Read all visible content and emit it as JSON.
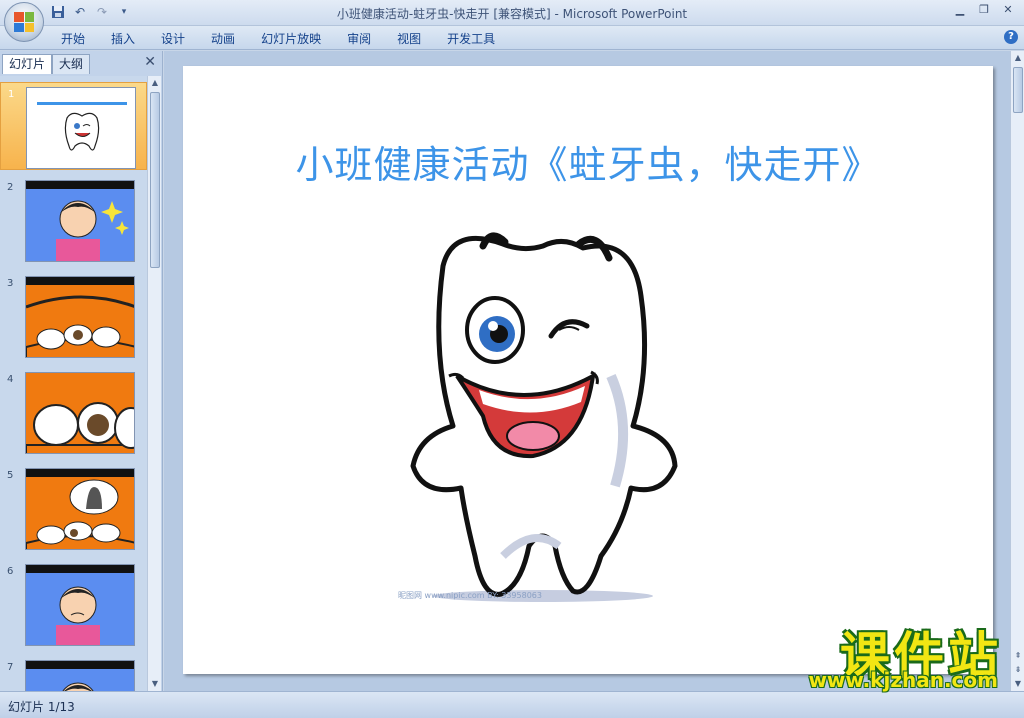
{
  "window": {
    "title": "小班健康活动-蛀牙虫-快走开 [兼容模式] - Microsoft PowerPoint",
    "minimize_icon": "minimize-icon",
    "restore_icon": "restore-icon",
    "close_icon": "close-icon"
  },
  "ribbon": {
    "tabs": [
      {
        "label": "开始"
      },
      {
        "label": "插入"
      },
      {
        "label": "设计"
      },
      {
        "label": "动画"
      },
      {
        "label": "幻灯片放映"
      },
      {
        "label": "审阅"
      },
      {
        "label": "视图"
      },
      {
        "label": "开发工具"
      }
    ],
    "help_icon": "help-icon"
  },
  "quick_access": {
    "icons": [
      "save-icon",
      "undo-icon",
      "redo-icon",
      "customize-icon"
    ]
  },
  "left_panel": {
    "tabs": [
      {
        "label": "幻灯片",
        "active": true
      },
      {
        "label": "大纲",
        "active": false
      }
    ],
    "close_icon": "close-icon",
    "thumbnails": [
      {
        "number": "1",
        "selected": true
      },
      {
        "number": "2",
        "selected": false
      },
      {
        "number": "3",
        "selected": false
      },
      {
        "number": "4",
        "selected": false
      },
      {
        "number": "5",
        "selected": false
      },
      {
        "number": "6",
        "selected": false
      },
      {
        "number": "7",
        "selected": false
      }
    ]
  },
  "slide": {
    "title": "小班健康活动《蛀牙虫，快走开》",
    "image_credit": "昵图网 www.nipic.com   BY: 33958063"
  },
  "status": {
    "text": "幻灯片 1/13"
  },
  "overlay": {
    "site_name": "课件站",
    "site_url": "www.kjzhan.com"
  },
  "colors": {
    "title_blue": "#3d94e8",
    "selection_orange": "#f7b34c",
    "slide_orange": "#f07a10",
    "slide_blue": "#5b8df0"
  }
}
